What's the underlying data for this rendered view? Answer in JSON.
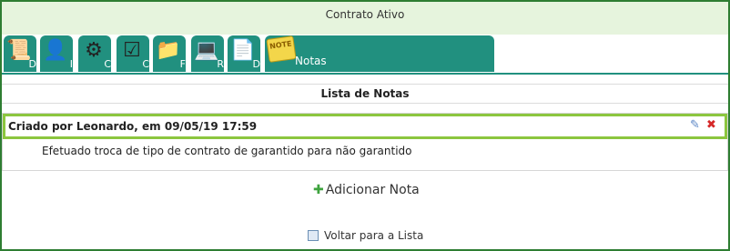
{
  "header": {
    "title": "Contrato Ativo"
  },
  "tabs": [
    {
      "icon": "certificate-icon",
      "letter": "D"
    },
    {
      "icon": "person-icon",
      "letter": "I"
    },
    {
      "icon": "gears-icon",
      "letter": "C"
    },
    {
      "icon": "checklist-icon",
      "letter": "C"
    },
    {
      "icon": "folder-icon",
      "letter": "F"
    },
    {
      "icon": "computer-transfer-icon",
      "letter": "R"
    },
    {
      "icon": "documents-icon",
      "letter": "D"
    },
    {
      "icon": "note-icon",
      "label": "Notas",
      "active": true
    }
  ],
  "list": {
    "title": "Lista de Notas"
  },
  "note": {
    "header": "Criado por Leonardo, em 09/05/19 17:59",
    "body": "Efetuado troca de tipo de contrato de garantido para não garantido"
  },
  "actions": {
    "add_note": "Adicionar Nota",
    "back": "Voltar para a Lista"
  },
  "colors": {
    "accent": "#21907f",
    "note_border": "#8cc63f",
    "header_bg": "#e6f4dd"
  }
}
